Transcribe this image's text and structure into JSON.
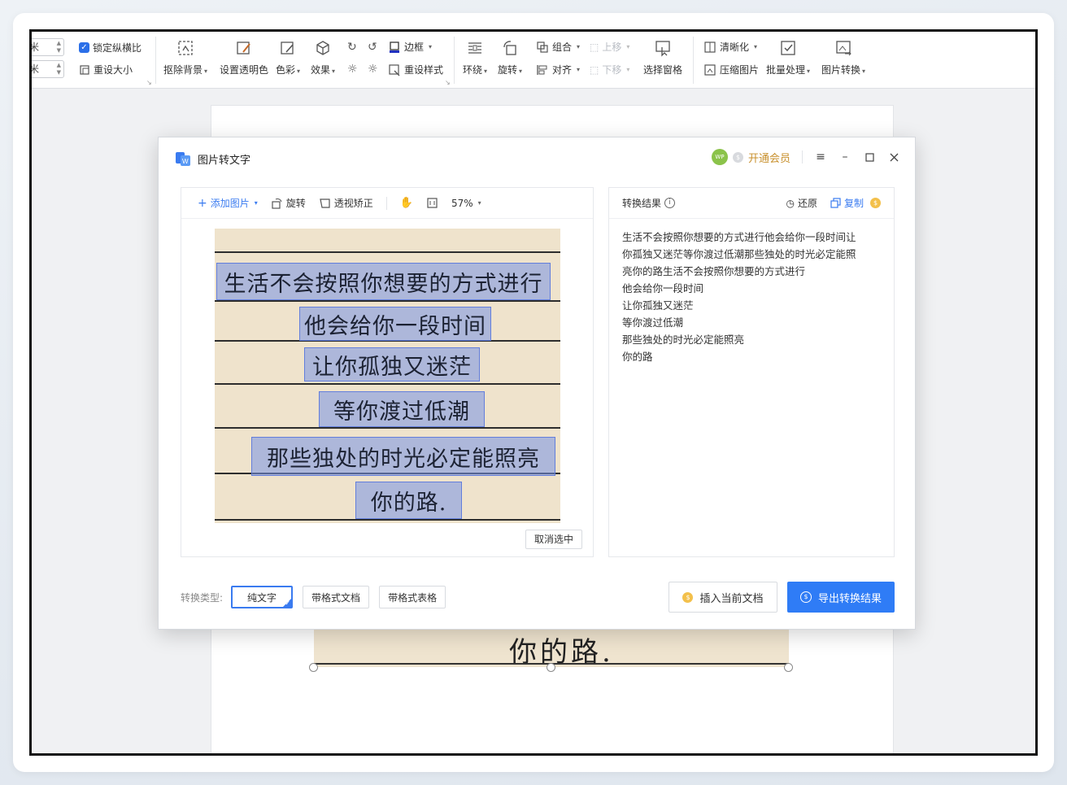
{
  "ribbon": {
    "width_unit": "米",
    "height_unit": "米",
    "lock_ratio_label": "锁定纵横比",
    "resize_label": "重设大小",
    "remove_bg_label": "抠除背景",
    "set_transparent_label": "设置透明色",
    "color_label": "色彩",
    "effect_label": "效果",
    "border_label": "边框",
    "reset_style_label": "重设样式",
    "wrap_label": "环绕",
    "rotate_label": "旋转",
    "group_label": "组合",
    "align_label": "对齐",
    "up_label": "上移",
    "down_label": "下移",
    "select_pane_label": "选择窗格",
    "sharpen_label": "清晰化",
    "compress_label": "压缩图片",
    "batch_label": "批量处理",
    "convert_label": "图片转换"
  },
  "dialog": {
    "title": "图片转文字",
    "avatar_text": "WP",
    "vip_label": "开通会员",
    "toolbar": {
      "add_image": "添加图片",
      "rotate": "旋转",
      "perspective": "透视矫正",
      "zoom": "57%"
    },
    "ocr_lines": [
      "生活不会按照你想要的方式进行",
      "他会给你一段时间",
      "让你孤独又迷茫",
      "等你渡过低潮",
      "那些独处的时光必定能照亮",
      "你的路."
    ],
    "cancel_select": "取消选中",
    "result": {
      "title": "转换结果",
      "restore": "还原",
      "copy": "复制",
      "lines": [
        "生活不会按照你想要的方式进行他会给你一段时间让",
        "你孤独又迷茫等你渡过低潮那些独处的时光必定能照",
        "亮你的路生活不会按照你想要的方式进行",
        "他会给你一段时间",
        "让你孤独又迷茫",
        "等你渡过低潮",
        "那些独处的时光必定能照亮",
        "你的路"
      ]
    },
    "bottom": {
      "type_label": "转换类型:",
      "plain_text": "纯文字",
      "formatted_doc": "带格式文档",
      "formatted_table": "带格式表格",
      "insert": "插入当前文档",
      "export": "导出转换结果"
    }
  },
  "document": {
    "image_text": "你的路."
  },
  "colors": {
    "accent": "#2f7cf6",
    "vip": "#c8902d",
    "ocr_highlight": "#7694e6"
  }
}
